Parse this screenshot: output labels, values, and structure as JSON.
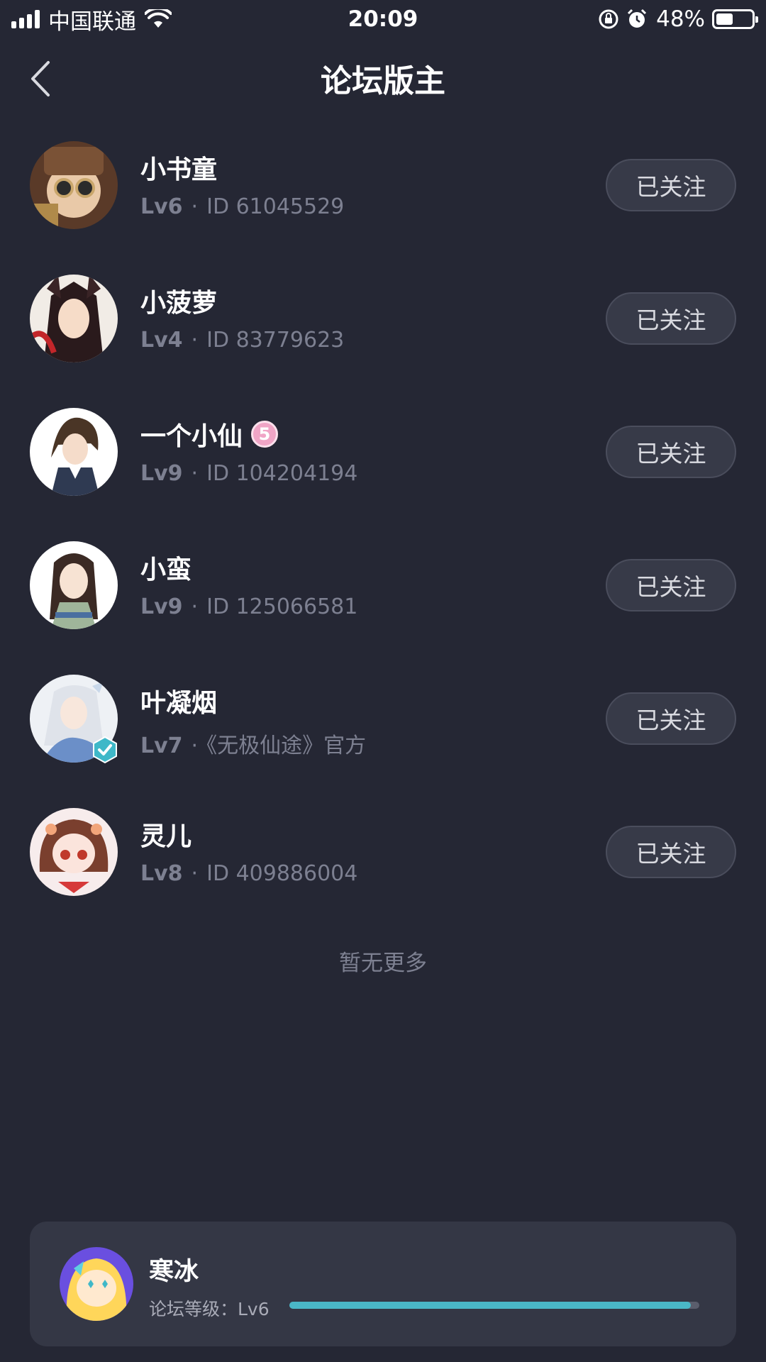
{
  "status_bar": {
    "carrier": "中国联通",
    "time": "20:09",
    "battery": "48%",
    "battery_level": 0.48
  },
  "header": {
    "title": "论坛版主"
  },
  "moderators": [
    {
      "name": "小书童",
      "level": "Lv6",
      "info": "ID 61045529",
      "button": "已关注"
    },
    {
      "name": "小菠萝",
      "level": "Lv4",
      "info": "ID 83779623",
      "button": "已关注"
    },
    {
      "name": "一个小仙",
      "level": "Lv9",
      "info": "ID 104204194",
      "button": "已关注",
      "badge": "5"
    },
    {
      "name": "小蛮",
      "level": "Lv9",
      "info": "ID 125066581",
      "button": "已关注"
    },
    {
      "name": "叶凝烟",
      "level": "Lv7",
      "info": "《无极仙途》官方",
      "button": "已关注"
    },
    {
      "name": "灵儿",
      "level": "Lv8",
      "info": "ID 409886004",
      "button": "已关注"
    }
  ],
  "footer_text": "暂无更多",
  "user_card": {
    "name": "寒冰",
    "level_label": "论坛等级：Lv6",
    "progress": 0.98
  },
  "colors": {
    "background": "#252734",
    "card": "#343745",
    "button": "#373a48",
    "progress": "#4ab7c7",
    "muted_text": "#7d8091"
  }
}
